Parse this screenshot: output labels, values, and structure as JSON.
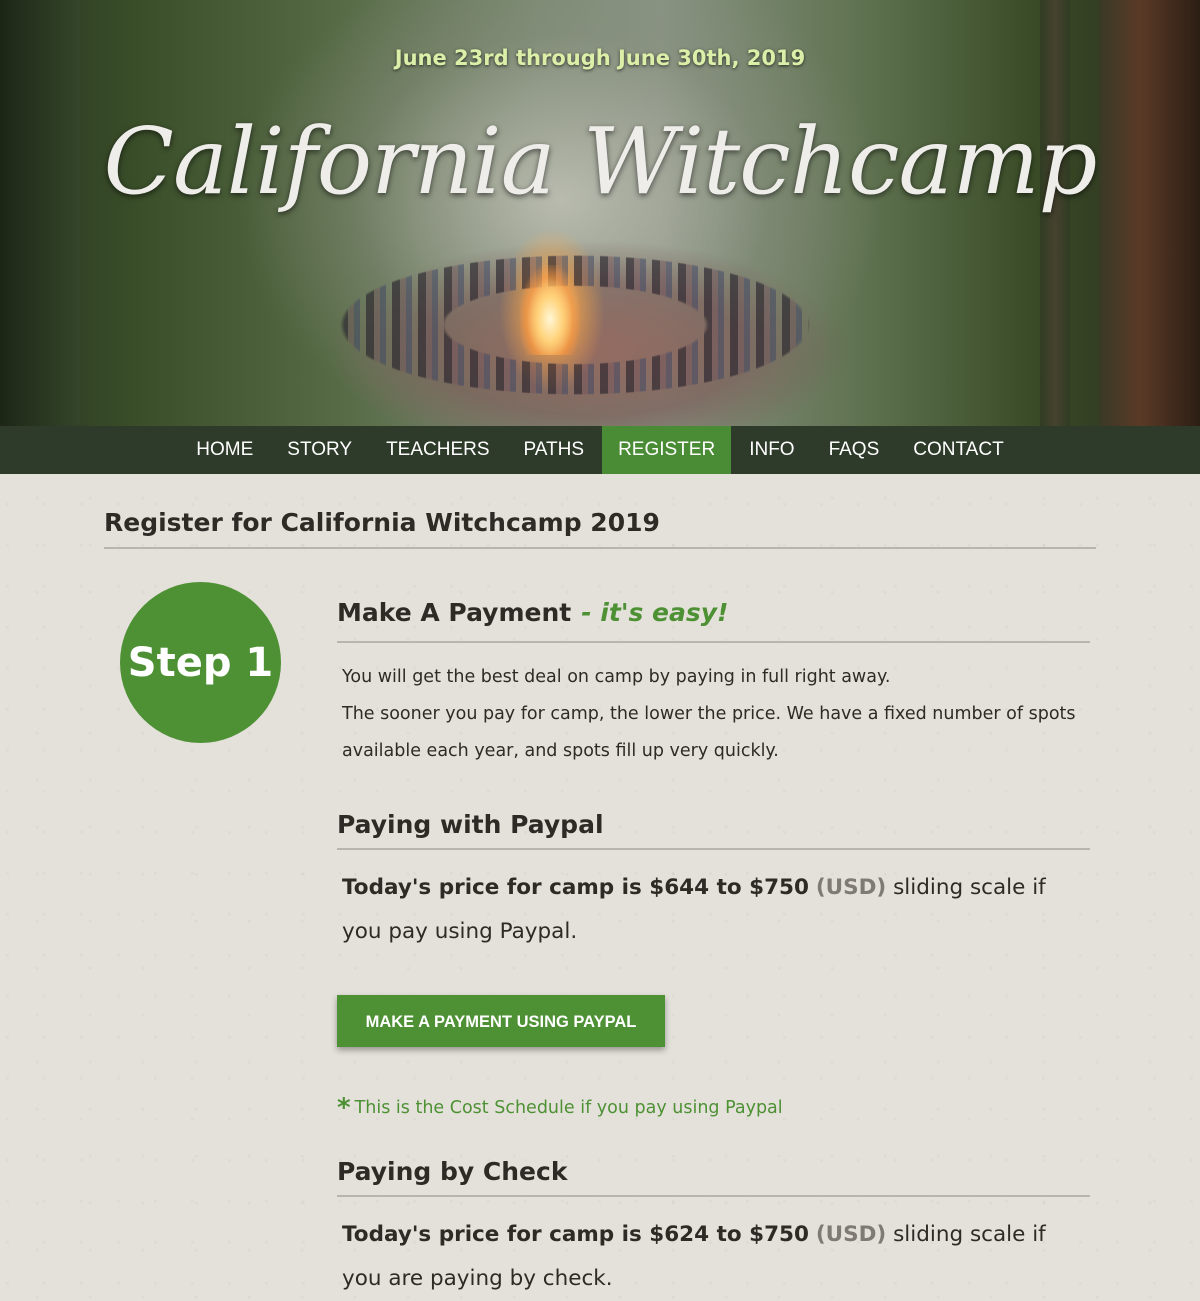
{
  "hero": {
    "date_range": "June 23rd through June 30th, 2019",
    "title": "California Witchcamp"
  },
  "nav": {
    "items": [
      "HOME",
      "STORY",
      "TEACHERS",
      "PATHS",
      "REGISTER",
      "INFO",
      "FAQS",
      "CONTACT"
    ],
    "active": "REGISTER"
  },
  "page": {
    "title": "Register for California Witchcamp 2019"
  },
  "step": {
    "label": "Step 1"
  },
  "payment": {
    "heading": "Make A Payment",
    "heading_accent": "- it's easy!",
    "intro_line1": "You will get the best deal on camp by paying in full right away.",
    "intro_line2": "The sooner you pay for camp, the lower the price. We have a fixed number of spots available each year, and spots fill up very quickly."
  },
  "paypal": {
    "heading": "Paying with Paypal",
    "price_bold": "Today's price for camp is $644 to $750",
    "currency": "(USD)",
    "price_rest": " sliding scale if you pay using Paypal.",
    "button_label": "MAKE A PAYMENT USING PAYPAL",
    "note_star": "*",
    "note": "This is the Cost Schedule if you pay using Paypal"
  },
  "check": {
    "heading": "Paying by Check",
    "price_bold": "Today's price for camp is $624 to $750",
    "currency": "(USD)",
    "price_rest": " sliding scale if you are paying by check."
  },
  "colors": {
    "accent_green": "#4e9135",
    "nav_bg": "#2e3b2a",
    "page_bg": "#e4e1da"
  }
}
